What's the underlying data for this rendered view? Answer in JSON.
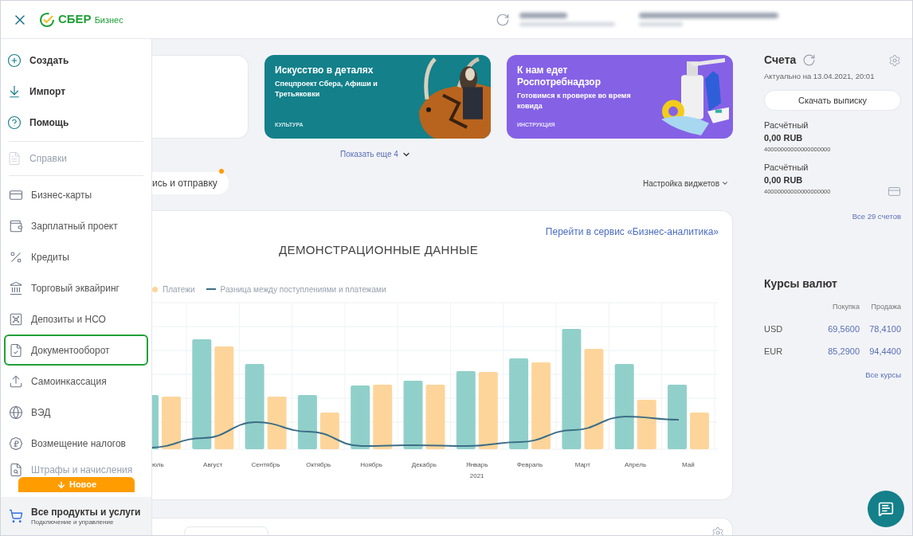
{
  "header": {
    "logo": {
      "brand": "СБЕР",
      "product": "Бизнес"
    }
  },
  "drawer": {
    "actions": [
      {
        "label": "Создать",
        "kind": "create"
      },
      {
        "label": "Импорт",
        "kind": "import"
      },
      {
        "label": "Помощь",
        "kind": "help"
      }
    ],
    "reports": {
      "label": "Справки",
      "disabled": true
    },
    "products": [
      {
        "label": "Бизнес-карты",
        "kind": "card",
        "selected": false
      },
      {
        "label": "Зарплатный проект",
        "kind": "wallet",
        "selected": false
      },
      {
        "label": "Кредиты",
        "kind": "percent",
        "selected": false
      },
      {
        "label": "Торговый эквайринг",
        "kind": "terminal",
        "selected": false
      },
      {
        "label": "Депозиты и НСО",
        "kind": "safe",
        "selected": false
      },
      {
        "label": "Документооборот",
        "kind": "doc",
        "selected": true
      },
      {
        "label": "Самоинкассация",
        "kind": "upload",
        "selected": false
      },
      {
        "label": "ВЭД",
        "kind": "globe",
        "selected": false
      },
      {
        "label": "Возмещение налогов",
        "kind": "refund",
        "selected": false
      },
      {
        "label": "Штрафы и начисления",
        "kind": "fine",
        "selected": false
      }
    ],
    "new_button": "Новое",
    "footer": {
      "title": "Все продукты и услуги",
      "subtitle": "Подключение и управление"
    }
  },
  "main": {
    "banners": [
      {
        "title": "Искусство в деталях",
        "subtitle": "Спецпроект Сбера, Афиши и Третьяковки",
        "tag": "КУЛЬТУРА",
        "color": "#13808a"
      },
      {
        "title": "К нам едет Роспотребнадзор",
        "subtitle": "Готовимся к проверке во время ковида",
        "tag": "ИНСТРУКЦИЯ",
        "color": "#8561e6"
      }
    ],
    "show_more": "Показать еще 4",
    "sign_pill": "ись и отправку",
    "widget_settings": "Настройка виджетов",
    "chart_card": {
      "link": "Перейти в сервис «Бизнес-аналитика»",
      "title": "ДЕМОНСТРАЦИОННЫЕ ДАННЫЕ",
      "legend": [
        {
          "label": "Платежи",
          "kind": "dot",
          "color": "#fdd59b"
        },
        {
          "label": "Разница между поступлениями и платежами",
          "kind": "line",
          "color": "#3c6e86"
        }
      ],
      "months": [
        {
          "label": "юль"
        },
        {
          "label": "Август"
        },
        {
          "label": "Сентябрь"
        },
        {
          "label": "Октябрь"
        },
        {
          "label": "Ноябрь"
        },
        {
          "label": "Декабрь"
        },
        {
          "label": "Январь",
          "year": "2021"
        },
        {
          "label": "Февраль"
        },
        {
          "label": "Март"
        },
        {
          "label": "Апрель"
        },
        {
          "label": "Май"
        }
      ]
    }
  },
  "accounts": {
    "title": "Счета",
    "updated": "Актуально на 13.04.2021, 20:01",
    "download": "Скачать выписку",
    "items": [
      {
        "type": "Расчётный",
        "amount": "0,00 RUB",
        "number": "40000000000000000000",
        "card": false
      },
      {
        "type": "Расчётный",
        "amount": "0,00 RUB",
        "number": "40000000000000000000",
        "card": true
      }
    ],
    "all_link": "Все 29 счетов"
  },
  "rates": {
    "title": "Курсы валют",
    "columns": [
      "Покупка",
      "Продажа"
    ],
    "rows": [
      {
        "currency": "USD",
        "buy": "69,5600",
        "sell": "78,4100"
      },
      {
        "currency": "EUR",
        "buy": "85,2900",
        "sell": "94,4400"
      }
    ],
    "all_link": "Все курсы"
  }
}
